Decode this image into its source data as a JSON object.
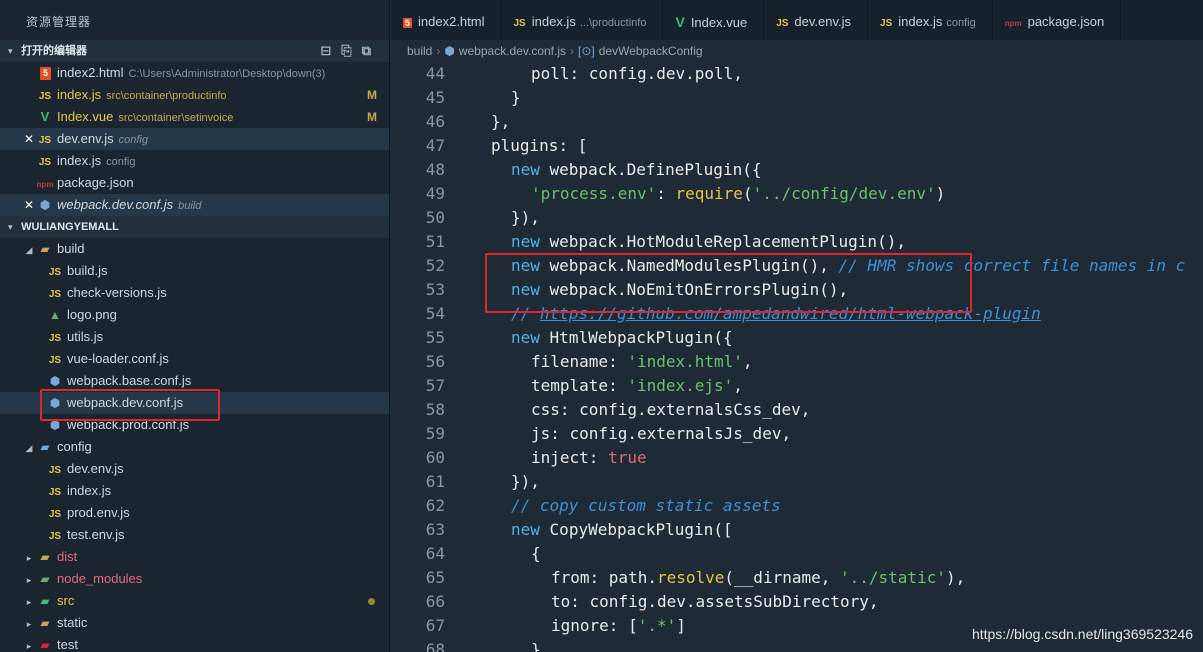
{
  "sidebar": {
    "title": "资源管理器",
    "open_editors": {
      "label": "打开的编辑器",
      "files": [
        {
          "name": "index2.html",
          "path": "C:\\Users\\Administrator\\Desktop\\down(3)",
          "icon": "html5-icon"
        },
        {
          "name": "index.js",
          "path": "src\\container\\productinfo",
          "badge": "M",
          "icon": "js-icon"
        },
        {
          "name": "Index.vue",
          "path": "src\\container\\setinvoice",
          "badge": "M",
          "icon": "vue-icon"
        },
        {
          "name": "dev.env.js",
          "path": "config",
          "icon": "js-icon"
        },
        {
          "name": "index.js",
          "path": "config",
          "icon": "js-icon"
        },
        {
          "name": "package.json",
          "path": "",
          "icon": "npm-icon"
        },
        {
          "name": "webpack.dev.conf.js",
          "path": "build",
          "icon": "webpack-icon"
        }
      ]
    },
    "project": {
      "label": "WULIANGYEMALL",
      "build_folder": "build",
      "build_files": [
        "build.js",
        "check-versions.js",
        "logo.png",
        "utils.js",
        "vue-loader.conf.js",
        "webpack.base.conf.js",
        "webpack.dev.conf.js",
        "webpack.prod.conf.js"
      ],
      "config_folder": "config",
      "config_files": [
        "dev.env.js",
        "index.js",
        "prod.env.js",
        "test.env.js"
      ],
      "other_folders": [
        "dist",
        "node_modules",
        "src",
        "static",
        "test"
      ]
    }
  },
  "tabs": [
    {
      "name": "index2.html",
      "hint": "",
      "icon": "html5-icon"
    },
    {
      "name": "index.js",
      "hint": "...\\productinfo",
      "icon": "js-icon"
    },
    {
      "name": "Index.vue",
      "hint": "",
      "icon": "vue-icon"
    },
    {
      "name": "dev.env.js",
      "hint": "",
      "icon": "js-icon"
    },
    {
      "name": "index.js",
      "hint": "config",
      "icon": "js-icon"
    },
    {
      "name": "package.json",
      "hint": "",
      "icon": "npm-icon"
    }
  ],
  "breadcrumb": {
    "folder": "build",
    "file": "webpack.dev.conf.js",
    "symbol": "devWebpackConfig"
  },
  "code": {
    "line_numbers": [
      "44",
      "45",
      "46",
      "47",
      "48",
      "49",
      "50",
      "51",
      "52",
      "53",
      "54",
      "55",
      "56",
      "57",
      "58",
      "59",
      "60",
      "61",
      "62",
      "63",
      "64",
      "65",
      "66",
      "67",
      "68"
    ],
    "l44a": "poll",
    "l44b": ": config.dev.poll,",
    "l45": "}",
    "l46": "},",
    "l47a": "plugins",
    "l47b": ": [",
    "l48a": "new",
    "l48b": " webpack.",
    "l48c": "DefinePlugin",
    "l48d": "({",
    "l49a": "'process.env'",
    "l49b": ": ",
    "l49c": "require",
    "l49d": "(",
    "l49e": "'../config/dev.env'",
    "l49f": ")",
    "l50": "}),",
    "l51a": "new",
    "l51b": " webpack.",
    "l51c": "HotModuleReplacementPlugin",
    "l51d": "(),",
    "l52a": "new",
    "l52b": " webpack.",
    "l52c": "NamedModulesPlugin",
    "l52d": "(), ",
    "l52e": "// HMR shows correct file names in c",
    "l53a": "new",
    "l53b": " webpack.",
    "l53c": "NoEmitOnErrorsPlugin",
    "l53d": "(),",
    "l54a": "// ",
    "l54b": "https://github.com/ampedandwired/html-webpack-plugin",
    "l55a": "new",
    "l55b": " ",
    "l55c": "HtmlWebpackPlugin",
    "l55d": "({",
    "l56a": "filename",
    "l56b": ": ",
    "l56c": "'index.html'",
    "l56d": ",",
    "l57a": "template",
    "l57b": ": ",
    "l57c": "'index.ejs'",
    "l57d": ",",
    "l58a": "css",
    "l58b": ": config.externalsCss_dev,",
    "l59a": "js",
    "l59b": ": config.externalsJs_dev,",
    "l60a": "inject",
    "l60b": ": ",
    "l60c": "true",
    "l61": "}),",
    "l62": "// copy custom static assets",
    "l63a": "new",
    "l63b": " ",
    "l63c": "CopyWebpackPlugin",
    "l63d": "([",
    "l64": "{",
    "l65a": "from",
    "l65b": ": path.",
    "l65c": "resolve",
    "l65d": "(__dirname, ",
    "l65e": "'../static'",
    "l65f": "),",
    "l66a": "to",
    "l66b": ": config.dev.assetsSubDirectory,",
    "l67a": "ignore",
    "l67b": ": [",
    "l67c": "'.*'",
    "l67d": "]",
    "l68": "}"
  },
  "watermark": "https://blog.csdn.net/ling369523246"
}
